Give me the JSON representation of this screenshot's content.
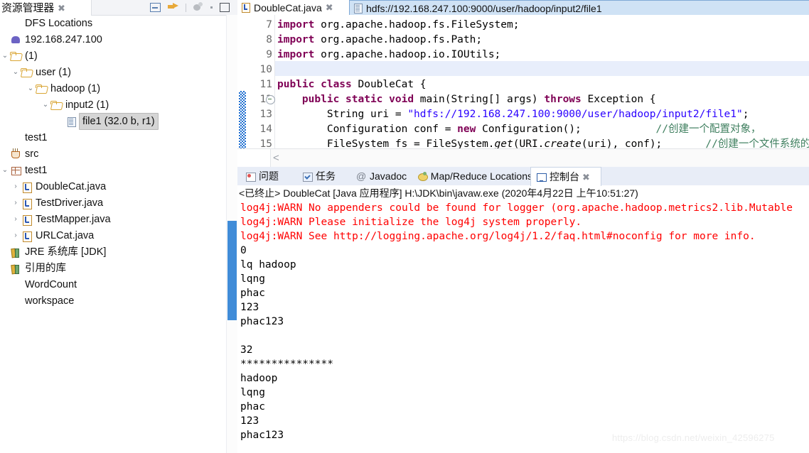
{
  "left_panel": {
    "tab_title": "资源管理器",
    "close_icon": "close-icon",
    "tools": [
      "minimize-icon",
      "forward-arrow-icon",
      "separator",
      "sphere-icon",
      "dot-icon",
      "maximize-icon"
    ],
    "tree": [
      {
        "label": "DFS Locations",
        "indent": 0,
        "arrow": "",
        "icon": "none"
      },
      {
        "label": "192.168.247.100",
        "indent": 0,
        "arrow": "",
        "icon": "elephant"
      },
      {
        "label": "(1)",
        "indent": 0,
        "arrow": "v",
        "icon": "folder"
      },
      {
        "label": "user (1)",
        "indent": 1,
        "arrow": "v",
        "icon": "folder"
      },
      {
        "label": "hadoop (1)",
        "indent": 2,
        "arrow": "v",
        "icon": "folder"
      },
      {
        "label": "input2 (1)",
        "indent": 3,
        "arrow": "v",
        "icon": "folder"
      },
      {
        "label": "file1 (32.0 b, r1)",
        "indent": 4,
        "arrow": "",
        "icon": "doc",
        "selected": true
      },
      {
        "label": "test1",
        "indent": 0,
        "arrow": "",
        "icon": "none"
      },
      {
        "label": "src",
        "indent": 0,
        "arrow": "",
        "icon": "src"
      },
      {
        "label": "test1",
        "indent": 0,
        "arrow": "v",
        "icon": "pkg"
      },
      {
        "label": "DoubleCat.java",
        "indent": 1,
        "arrow": ">",
        "icon": "java"
      },
      {
        "label": "TestDriver.java",
        "indent": 1,
        "arrow": ">",
        "icon": "java"
      },
      {
        "label": "TestMapper.java",
        "indent": 1,
        "arrow": ">",
        "icon": "java"
      },
      {
        "label": "URLCat.java",
        "indent": 1,
        "arrow": ">",
        "icon": "java"
      },
      {
        "label": "JRE 系统库 [JDK]",
        "indent": 0,
        "arrow": "",
        "icon": "lib"
      },
      {
        "label": "引用的库",
        "indent": 0,
        "arrow": "",
        "icon": "lib"
      },
      {
        "label": "WordCount",
        "indent": 0,
        "arrow": "",
        "icon": "none"
      },
      {
        "label": "workspace",
        "indent": 0,
        "arrow": "",
        "icon": "none"
      }
    ]
  },
  "editor": {
    "tabs": [
      {
        "label": "DoubleCat.java",
        "icon": "java-file-icon",
        "active": true,
        "closable": true
      },
      {
        "label": "hdfs://192.168.247.100:9000/user/hadoop/input2/file1",
        "icon": "file-icon",
        "active": false,
        "closable": false
      }
    ],
    "close_icon": "close-icon",
    "line_numbers": [
      "7",
      "8",
      "9",
      "10",
      "11",
      "12",
      "13",
      "14",
      "15"
    ],
    "highlighted_line": "10",
    "fold_marker_line": "12",
    "code_lines": [
      {
        "n": "7",
        "segments": [
          {
            "t": "import",
            "c": "kw"
          },
          {
            "t": " org.apache.hadoop.fs.FileSystem;",
            "c": ""
          }
        ]
      },
      {
        "n": "8",
        "segments": [
          {
            "t": "import",
            "c": "kw"
          },
          {
            "t": " org.apache.hadoop.fs.Path;",
            "c": ""
          }
        ]
      },
      {
        "n": "9",
        "segments": [
          {
            "t": "import",
            "c": "kw"
          },
          {
            "t": " org.apache.hadoop.io.IOUtils;",
            "c": ""
          }
        ]
      },
      {
        "n": "10",
        "segments": [
          {
            "t": "",
            "c": ""
          }
        ]
      },
      {
        "n": "11",
        "segments": [
          {
            "t": "public class",
            "c": "kw"
          },
          {
            "t": " DoubleCat {",
            "c": ""
          }
        ]
      },
      {
        "n": "12",
        "segments": [
          {
            "t": "    ",
            "c": ""
          },
          {
            "t": "public static void",
            "c": "kw"
          },
          {
            "t": " main(String[] args) ",
            "c": ""
          },
          {
            "t": "throws",
            "c": "kw"
          },
          {
            "t": " Exception {",
            "c": ""
          }
        ]
      },
      {
        "n": "13",
        "segments": [
          {
            "t": "        String uri = ",
            "c": ""
          },
          {
            "t": "\"hdfs://192.168.247.100:9000/user/hadoop/input2/file1\"",
            "c": "str"
          },
          {
            "t": ";",
            "c": ""
          }
        ]
      },
      {
        "n": "14",
        "segments": [
          {
            "t": "        Configuration conf = ",
            "c": ""
          },
          {
            "t": "new",
            "c": "kw"
          },
          {
            "t": " Configuration();",
            "c": ""
          },
          {
            "t": "            //创建一个配置对象，",
            "c": "cmt"
          }
        ]
      },
      {
        "n": "15",
        "segments": [
          {
            "t": "        FileSystem fs = FileSystem.",
            "c": ""
          },
          {
            "t": "get",
            "c": "ital"
          },
          {
            "t": "(URI.",
            "c": ""
          },
          {
            "t": "create",
            "c": "ital"
          },
          {
            "t": "(uri), conf);",
            "c": ""
          },
          {
            "t": "       //创建一个文件系统的",
            "c": "cmt"
          }
        ]
      }
    ],
    "hscroll_left_arrow": "<"
  },
  "bottom_panel": {
    "tabs": [
      {
        "label": "问题",
        "icon": "problems-icon",
        "active": false
      },
      {
        "label": "任务",
        "icon": "tasks-icon",
        "active": false
      },
      {
        "label": "Javadoc",
        "icon": "javadoc-at-icon",
        "active": false
      },
      {
        "label": "Map/Reduce Locations",
        "icon": "mapreduce-icon",
        "active": false
      },
      {
        "label": "控制台",
        "icon": "console-icon",
        "active": true,
        "closable": true
      }
    ],
    "close_icon": "close-icon",
    "console_header": "<已终止> DoubleCat [Java 应用程序] H:\\JDK\\bin\\javaw.exe  (2020年4月22日 上午10:51:27)",
    "console_lines": [
      {
        "text": "log4j:WARN No appenders could be found for logger (org.apache.hadoop.metrics2.lib.Mutable",
        "color": "red"
      },
      {
        "text": "log4j:WARN Please initialize the log4j system properly.",
        "color": "red"
      },
      {
        "text": "log4j:WARN See http://logging.apache.org/log4j/1.2/faq.html#noconfig for more info.",
        "color": "red"
      },
      {
        "text": "0",
        "color": "black"
      },
      {
        "text": "lq hadoop",
        "color": "black"
      },
      {
        "text": "lqng",
        "color": "black"
      },
      {
        "text": "phac",
        "color": "black"
      },
      {
        "text": "123",
        "color": "black"
      },
      {
        "text": "phac123",
        "color": "black"
      },
      {
        "text": "",
        "color": "black"
      },
      {
        "text": "32",
        "color": "black"
      },
      {
        "text": "***************",
        "color": "black"
      },
      {
        "text": "hadoop",
        "color": "black"
      },
      {
        "text": "lqng",
        "color": "black"
      },
      {
        "text": "phac",
        "color": "black"
      },
      {
        "text": "123",
        "color": "black"
      },
      {
        "text": "phac123",
        "color": "black"
      }
    ]
  },
  "watermark": "https://blog.csdn.net/weixin_42596275",
  "colors": {
    "keyword": "#7f0055",
    "string": "#2a00ff",
    "comment": "#3f7f5f",
    "error": "#ff0000",
    "accent": "#2b7fd4"
  }
}
